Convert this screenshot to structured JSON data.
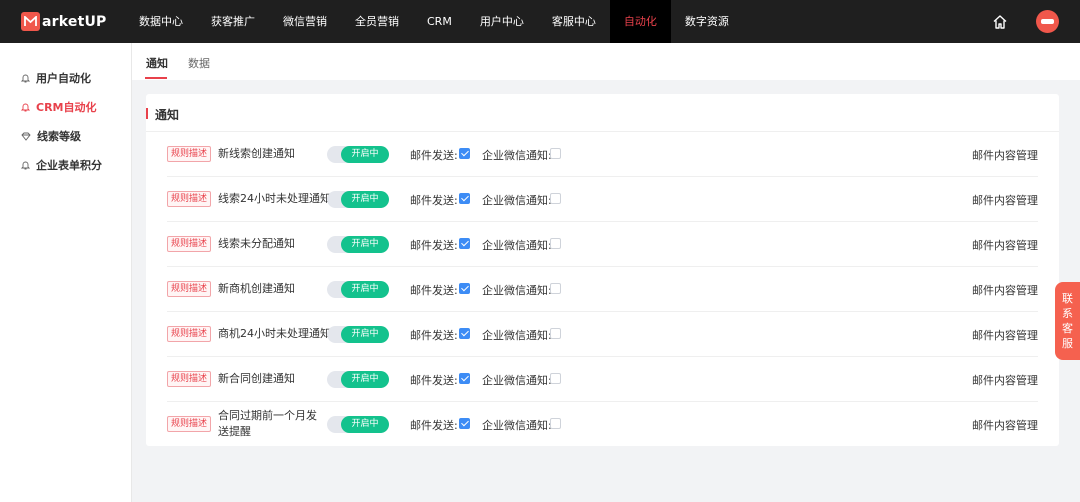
{
  "brand": {
    "logo_text": "arketUP"
  },
  "nav": {
    "items": [
      {
        "label": "数据中心"
      },
      {
        "label": "获客推广"
      },
      {
        "label": "微信营销"
      },
      {
        "label": "全员营销"
      },
      {
        "label": "CRM"
      },
      {
        "label": "用户中心"
      },
      {
        "label": "客服中心"
      },
      {
        "label": "自动化",
        "active": true
      },
      {
        "label": "数字资源"
      }
    ]
  },
  "sidebar": {
    "items": [
      {
        "label": "用户自动化",
        "icon": "bell-icon"
      },
      {
        "label": "CRM自动化",
        "icon": "bell-icon",
        "active": true
      },
      {
        "label": "线索等级",
        "icon": "diamond-icon"
      },
      {
        "label": "企业表单积分",
        "icon": "bell-icon"
      }
    ]
  },
  "tabs": [
    {
      "label": "通知",
      "active": true
    },
    {
      "label": "数据"
    }
  ],
  "card": {
    "title": "通知"
  },
  "rows": [
    {
      "badge": "规则描述",
      "name": "新线索创建通知",
      "toggle": "开启中",
      "mail_label": "邮件发送:",
      "mail_checked": true,
      "wx_label": "企业微信通知:",
      "wx_checked": false,
      "action": "邮件内容管理"
    },
    {
      "badge": "规则描述",
      "name": "线索24小时未处理通知",
      "toggle": "开启中",
      "mail_label": "邮件发送:",
      "mail_checked": true,
      "wx_label": "企业微信通知:",
      "wx_checked": false,
      "action": "邮件内容管理"
    },
    {
      "badge": "规则描述",
      "name": "线索未分配通知",
      "toggle": "开启中",
      "mail_label": "邮件发送:",
      "mail_checked": true,
      "wx_label": "企业微信通知:",
      "wx_checked": false,
      "action": "邮件内容管理"
    },
    {
      "badge": "规则描述",
      "name": "新商机创建通知",
      "toggle": "开启中",
      "mail_label": "邮件发送:",
      "mail_checked": true,
      "wx_label": "企业微信通知:",
      "wx_checked": false,
      "action": "邮件内容管理"
    },
    {
      "badge": "规则描述",
      "name": "商机24小时未处理通知",
      "toggle": "开启中",
      "mail_label": "邮件发送:",
      "mail_checked": true,
      "wx_label": "企业微信通知:",
      "wx_checked": false,
      "action": "邮件内容管理"
    },
    {
      "badge": "规则描述",
      "name": "新合同创建通知",
      "toggle": "开启中",
      "mail_label": "邮件发送:",
      "mail_checked": true,
      "wx_label": "企业微信通知:",
      "wx_checked": false,
      "action": "邮件内容管理"
    },
    {
      "badge": "规则描述",
      "name": "合同过期前一个月发送提醒",
      "toggle": "开启中",
      "mail_label": "邮件发送:",
      "mail_checked": true,
      "wx_label": "企业微信通知:",
      "wx_checked": false,
      "action": "邮件内容管理"
    }
  ],
  "contact": {
    "label": "联系客服"
  },
  "colors": {
    "accent": "#e8414b",
    "toggle_on": "#13c28d",
    "checkbox": "#3d8cf5",
    "topbar": "#1f1f1f"
  }
}
